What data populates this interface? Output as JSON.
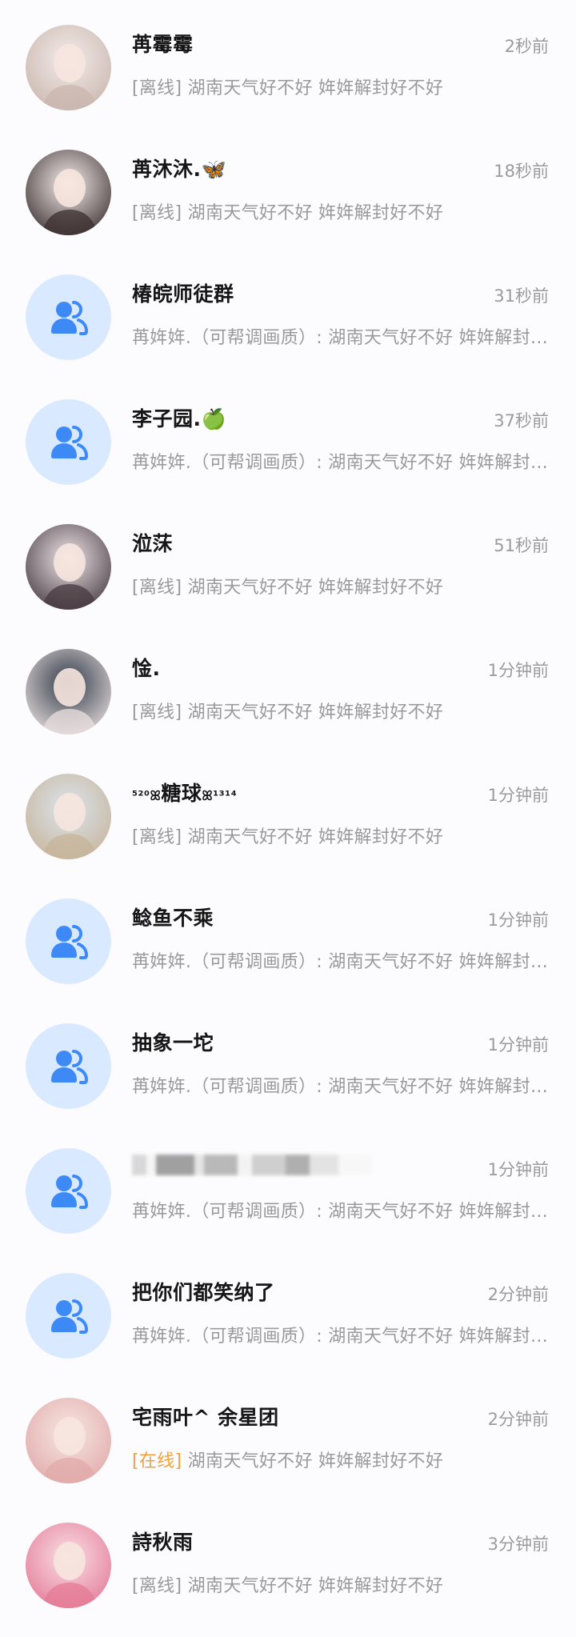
{
  "chats": [
    {
      "name": "苒霉霉",
      "time": "2秒前",
      "type": "person",
      "status": "[离线]",
      "message": " 湖南天气好不好 姩姩解封好不好",
      "avatar_colors": [
        "#f3ecea",
        "#c9b5ad"
      ]
    },
    {
      "name": "苒沐沐.",
      "emoji": "🦋",
      "time": "18秒前",
      "type": "person",
      "status": "[离线]",
      "message": " 湖南天气好不好 姩姩解封好不好",
      "avatar_colors": [
        "#f7eeee",
        "#3b2f2f"
      ]
    },
    {
      "name": "椿皖师徒群",
      "time": "31秒前",
      "type": "group",
      "message": "苒姩姩.（可帮调画质）: 湖南天气好不好 姩姩解封好不好"
    },
    {
      "name": "李子园.",
      "emoji": "🍏",
      "time": "37秒前",
      "type": "group",
      "message": "苒姩姩.（可帮调画质）: 湖南天气好不好 姩姩解封好不好"
    },
    {
      "name": "涖莯",
      "time": "51秒前",
      "type": "person",
      "status": "[离线]",
      "message": " 湖南天气好不好 姩姩解封好不好",
      "avatar_colors": [
        "#efe6ea",
        "#463a3f"
      ]
    },
    {
      "name": "惍.",
      "time": "1分钟前",
      "type": "person",
      "status": "[离线]",
      "message": " 湖南天气好不好 姩姩解封好不好",
      "avatar_colors": [
        "#2f3a48",
        "#eadfdf"
      ]
    },
    {
      "name_prefix": "⁵²⁰ꕤ",
      "name": "糖球",
      "name_suffix": "ꕤ¹³¹⁴",
      "time": "1分钟前",
      "type": "person",
      "status": "[离线]",
      "message": " 湖南天气好不好 姩姩解封好不好",
      "avatar_colors": [
        "#dbe4ee",
        "#c7b49a"
      ]
    },
    {
      "name": "鲶鱼不乘",
      "time": "1分钟前",
      "type": "group",
      "message": "苒姩姩.（可帮调画质）: 湖南天气好不好 姩姩解封好不好"
    },
    {
      "name": "抽象一坨",
      "time": "1分钟前",
      "type": "group",
      "message": "苒姩姩.（可帮调画质）: 湖南天气好不好 姩姩解封好不好"
    },
    {
      "name": "",
      "blurred": true,
      "time": "1分钟前",
      "type": "group",
      "message": "苒姩姩.（可帮调画质）: 湖南天气好不好 姩姩解封好不好"
    },
    {
      "name": "把你们都笑纳了",
      "time": "2分钟前",
      "type": "group",
      "message": "苒姩姩.（可帮调画质）: 湖南天气好不好 姩姩解封好不好"
    },
    {
      "name": "宅雨叶^ 余星团",
      "time": "2分钟前",
      "type": "person",
      "status": "[在线]",
      "online": true,
      "message": " 湖南天气好不好 姩姩解封好不好",
      "avatar_colors": [
        "#f6e7e2",
        "#e1a9a9"
      ]
    },
    {
      "name": "詩秋雨",
      "time": "3分钟前",
      "type": "person",
      "status": "[离线]",
      "message": " 湖南天气好不好 姩姩解封好不好",
      "avatar_colors": [
        "#f9dfe6",
        "#e47a96"
      ]
    }
  ],
  "colors": {
    "group_avatar_bg": "#d9e9ff",
    "group_icon": "#3d8af7",
    "online_status": "#f0a23a",
    "secondary_text": "#9a9a9a",
    "name_text": "#161616"
  },
  "icons": {
    "group": "group-people-icon"
  }
}
